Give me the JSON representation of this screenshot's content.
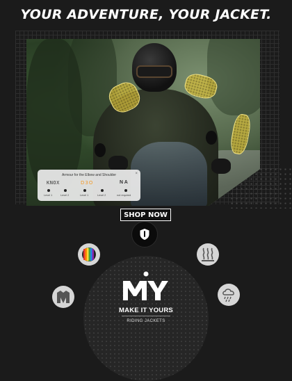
{
  "banner": {
    "headline": "YOUR ADVENTURE, YOUR JACKET.",
    "shop_now_label": "SHOP NOW"
  },
  "armour_card": {
    "title": "Armour for the Elbow and Shoulder",
    "close": "×",
    "brands": [
      "KNOX",
      "D3O",
      "N A"
    ],
    "levels": [
      "Level 1",
      "Level 2",
      "Level 1",
      "Level 2",
      "not required"
    ]
  },
  "features": [
    {
      "name": "color-options-icon",
      "label": "Color options"
    },
    {
      "name": "insulated-icon",
      "label": "Insulated"
    },
    {
      "name": "jacket-icon",
      "label": "Jacket"
    },
    {
      "name": "weather-icon",
      "label": "Weather"
    }
  ],
  "my_logo": {
    "letters": "MY",
    "tagline": "MAKE IT YOURS",
    "subtitle": "RIDING JACKETS"
  },
  "colors": {
    "background": "#1b1b1b",
    "armor_yellow": "#d6be3c",
    "d3o_orange": "#f29a2b"
  }
}
